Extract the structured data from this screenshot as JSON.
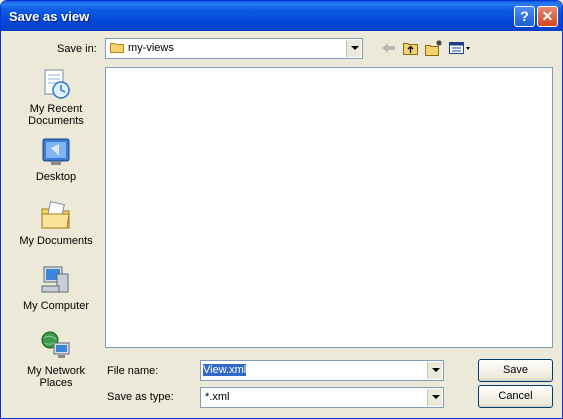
{
  "window": {
    "title": "Save as view"
  },
  "titlebar_buttons": {
    "help_symbol": "?",
    "close_symbol": "✕"
  },
  "save_in": {
    "label": "Save in:",
    "value": "my-views"
  },
  "toolbar": {
    "icons": [
      "back-arrow-icon",
      "up-one-level-icon",
      "create-new-folder-icon",
      "views-menu-icon"
    ]
  },
  "places": [
    {
      "label": "My Recent Documents",
      "icon": "recent-documents-icon"
    },
    {
      "label": "Desktop",
      "icon": "desktop-icon"
    },
    {
      "label": "My Documents",
      "icon": "my-documents-icon"
    },
    {
      "label": "My Computer",
      "icon": "my-computer-icon"
    },
    {
      "label": "My Network Places",
      "icon": "network-places-icon"
    }
  ],
  "file_name": {
    "label": "File name:",
    "value": "View.xml"
  },
  "save_as_type": {
    "label": "Save as type:",
    "value": "*.xml"
  },
  "buttons": {
    "save": "Save",
    "cancel": "Cancel"
  }
}
